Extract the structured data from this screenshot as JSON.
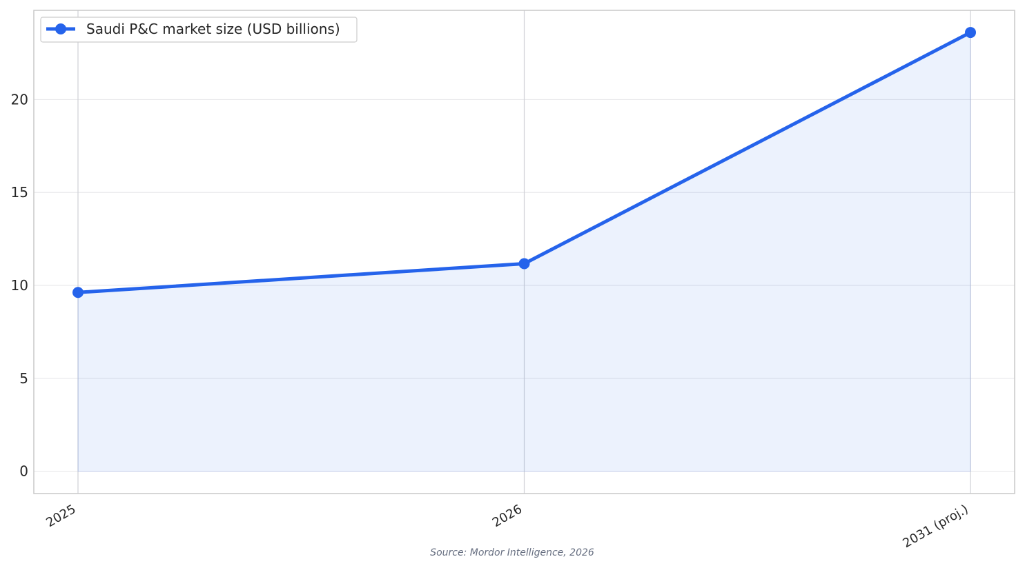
{
  "chart_data": {
    "type": "line",
    "categories": [
      "2025",
      "2026",
      "2031 (proj.)"
    ],
    "series": [
      {
        "name": "Saudi P&C market size (USD billions)",
        "values": [
          9.62,
          11.17,
          23.61
        ],
        "color": "#2563eb",
        "fill_color": "#2563eb"
      }
    ],
    "yticks": [
      0,
      5,
      10,
      15,
      20
    ],
    "ylim": [
      -1.2,
      24.8
    ],
    "grid": true,
    "area_fill": true,
    "markers": true,
    "legend_position": "top-left",
    "source": "Source: Mordor Intelligence, 2026"
  }
}
